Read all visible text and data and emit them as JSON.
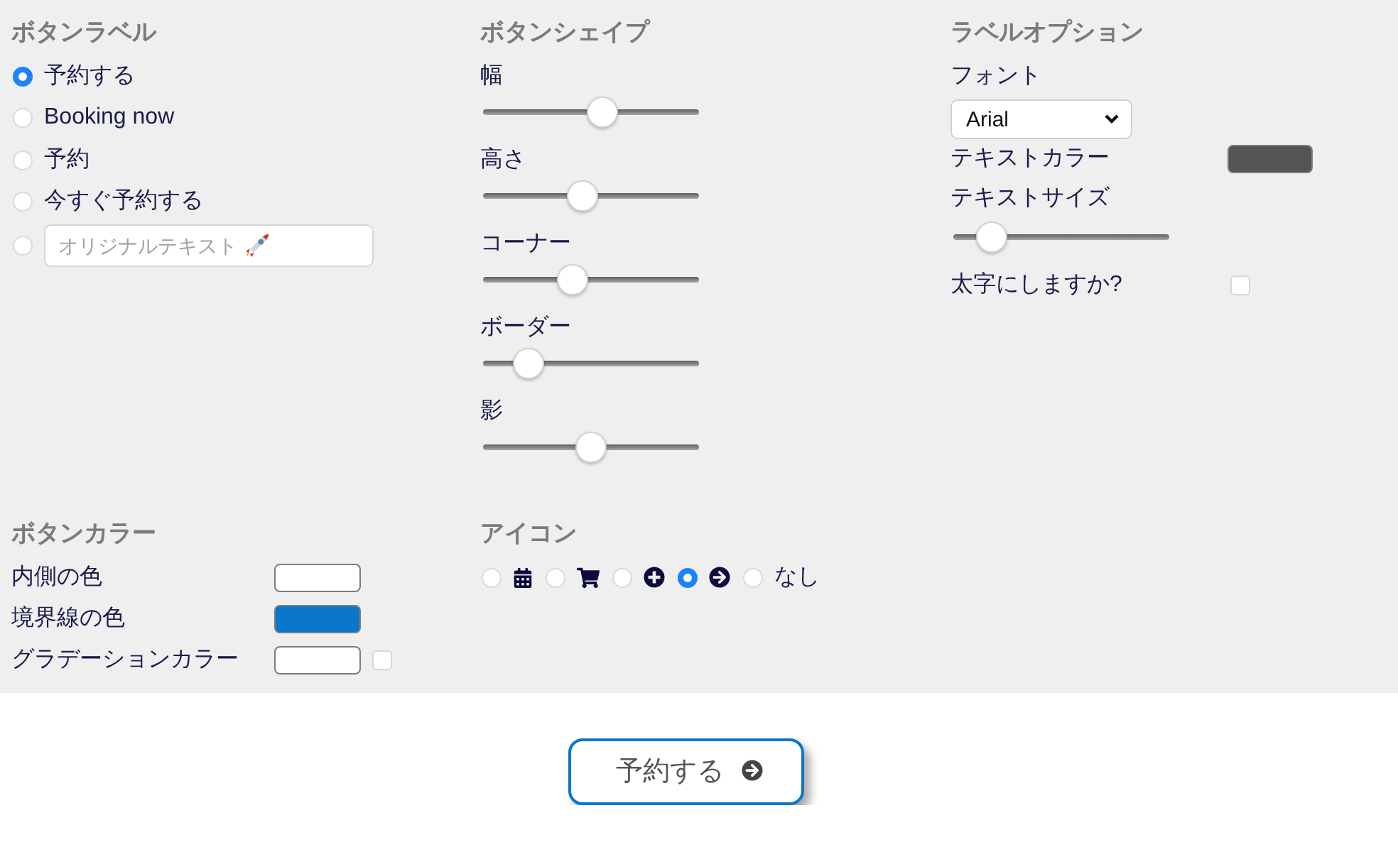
{
  "button_label": {
    "title": "ボタンラベル",
    "options": [
      {
        "kind": "text",
        "label": "予約する",
        "selected": true
      },
      {
        "kind": "text",
        "label": "Booking now",
        "selected": false
      },
      {
        "kind": "text",
        "label": "予約",
        "selected": false
      },
      {
        "kind": "text",
        "label": "今すぐ予約する",
        "selected": false
      },
      {
        "kind": "input",
        "placeholder": "オリジナルテキスト",
        "selected": false
      }
    ]
  },
  "button_shape": {
    "title": "ボタンシェイプ",
    "sliders": [
      {
        "label": "幅",
        "level": 0.56
      },
      {
        "label": "高さ",
        "level": 0.45
      },
      {
        "label": "コーナー",
        "level": 0.4
      },
      {
        "label": "ボーダー",
        "level": 0.16
      },
      {
        "label": "影",
        "level": 0.5
      }
    ]
  },
  "label_options": {
    "title": "ラベルオプション",
    "font": {
      "label": "フォント",
      "value": "Arial"
    },
    "text_color": {
      "label": "テキストカラー",
      "color": "#555555"
    },
    "text_size": {
      "label": "テキストサイズ",
      "level": 0.12
    },
    "bold": {
      "label": "太字にしますか?",
      "checked": false
    }
  },
  "button_color": {
    "title": "ボタンカラー",
    "rows": [
      {
        "label": "内側の色",
        "color": "#ffffff"
      },
      {
        "label": "境界線の色",
        "color": "#0a77cc"
      },
      {
        "label": "グラデーションカラー",
        "color": "#ffffff",
        "checked": false
      }
    ]
  },
  "icon": {
    "title": "アイコン",
    "options": [
      {
        "kind": "calendar",
        "selected": false
      },
      {
        "kind": "cart",
        "selected": false
      },
      {
        "kind": "plus",
        "selected": false
      },
      {
        "kind": "arrow",
        "selected": true
      },
      {
        "kind": "text",
        "label": "なし",
        "selected": false
      }
    ]
  },
  "preview": {
    "label": "予約する"
  }
}
